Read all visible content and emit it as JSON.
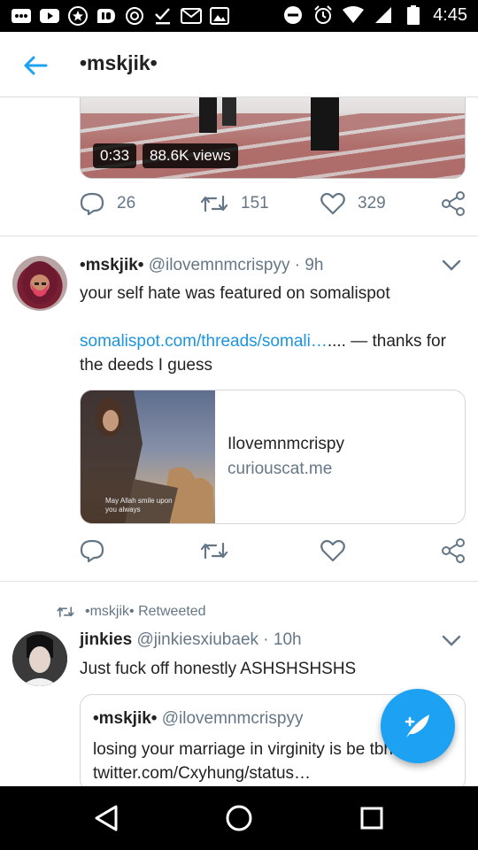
{
  "status_bar": {
    "time": "4:45",
    "left_icons": [
      "messages-icon",
      "youtube-icon",
      "star-icon",
      "pushbullet-icon",
      "sync-icon",
      "download-icon",
      "gmail-icon",
      "gallery-icon"
    ],
    "right_icons": [
      "dnd-icon",
      "alarm-icon",
      "wifi-icon",
      "signal-icon",
      "battery-icon"
    ]
  },
  "app_bar": {
    "title": "•mskjik•"
  },
  "media_tweet": {
    "duration": "0:33",
    "views": "88.6K views",
    "replies": "26",
    "retweets": "151",
    "likes": "329"
  },
  "tweet1": {
    "display_name": "•mskjik•",
    "handle": "@ilovemnmcrispyy",
    "time": "· 9h",
    "text_line1": "your self hate was featured on somalispot",
    "link_text": "somalispot.com/threads/somali…",
    "text_after_link": ".... — thanks for the deeds I guess",
    "card": {
      "thumb_caption": "May Allah smile upon you always",
      "title": "Ilovemnmcrispy",
      "domain": "curiouscat.me"
    }
  },
  "tweet2": {
    "retweet_label": "•mskjik• Retweeted",
    "display_name": "jinkies",
    "handle": "@jinkiesxiubaek",
    "time": "· 10h",
    "text": "Just fuck off honestly ASHSHSHSHS",
    "quote": {
      "display_name": "•mskjik•",
      "handle": "@ilovemnmcrispyy",
      "text": "losing your marriage in virginity is be tbh twitter.com/Cxyhung/status…"
    }
  },
  "colors": {
    "accent": "#1da1f2",
    "link": "#1b95e0",
    "muted": "#657786"
  }
}
